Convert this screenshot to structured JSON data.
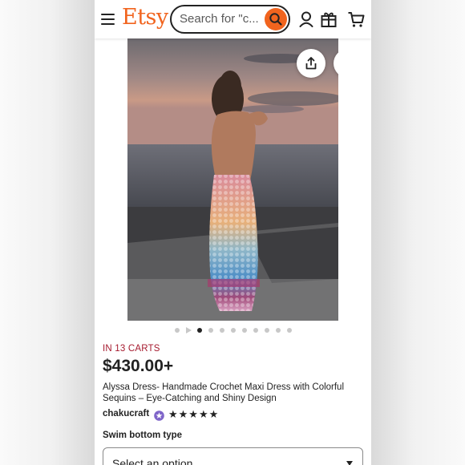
{
  "header": {
    "logo": "Etsy",
    "search_placeholder": "Search for \"c...",
    "icons": [
      "menu-icon",
      "search-icon",
      "account-icon",
      "gift-icon",
      "cart-icon"
    ]
  },
  "gallery": {
    "actions": [
      "share-icon",
      "heart-icon"
    ],
    "image_count": 10,
    "active_index": 1,
    "video_index": 0
  },
  "product": {
    "carts_badge": "IN 13 CARTS",
    "price": "$430.00+",
    "title": "Alyssa Dress- Handmade Crochet Maxi Dress with Colorful Sequins – Eye-Catching and Shiny Design",
    "seller": "chakucraft",
    "rating_stars": "★★★★★",
    "rating": 5
  },
  "options": {
    "label": "Swim bottom type",
    "select_placeholder": "Select an option"
  },
  "colors": {
    "brand": "#f1641e",
    "badge": "#a61a2e",
    "star_seller": "#7f65c9"
  }
}
